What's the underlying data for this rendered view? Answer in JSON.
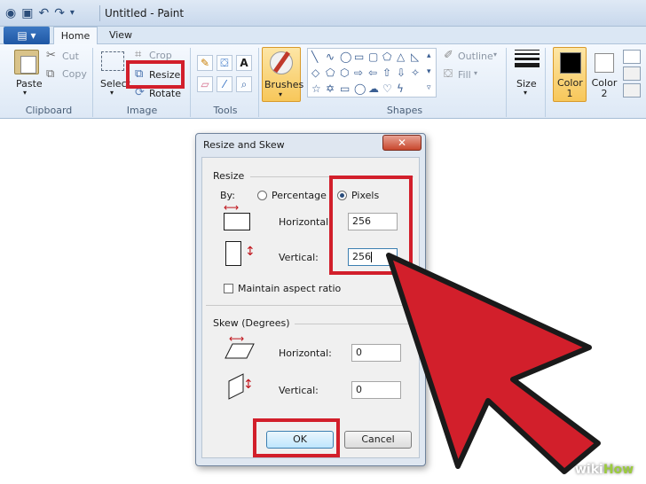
{
  "window": {
    "title": "Untitled - Paint"
  },
  "tabs": [
    {
      "label": "Home"
    },
    {
      "label": "View"
    }
  ],
  "ribbon": {
    "clipboard": {
      "label": "Clipboard",
      "paste": "Paste",
      "cut": "Cut",
      "copy": "Copy"
    },
    "image": {
      "label": "Image",
      "select": "Select",
      "crop": "Crop",
      "resize": "Resize",
      "rotate": "Rotate"
    },
    "tools": {
      "label": "Tools"
    },
    "brushes": {
      "label": "Brushes"
    },
    "shapes": {
      "label": "Shapes",
      "outline": "Outline",
      "fill": "Fill"
    },
    "size": {
      "label": "Size"
    },
    "color1": {
      "label": "Color\n1"
    },
    "color2": {
      "label": "Color\n2"
    }
  },
  "colors": {
    "color1": "#000000",
    "color2": "#ffffff",
    "highlight": "#d21f2b"
  },
  "dialog": {
    "title": "Resize and Skew",
    "resize": {
      "label": "Resize",
      "by": "By:",
      "percentage": "Percentage",
      "pixels": "Pixels",
      "selected": "Pixels",
      "horizontal_label": "Horizontal:",
      "horizontal_value": "256",
      "vertical_label": "Vertical:",
      "vertical_value": "256",
      "maintain_aspect": "Maintain aspect ratio"
    },
    "skew": {
      "label": "Skew (Degrees)",
      "horizontal_label": "Horizontal:",
      "horizontal_value": "0",
      "vertical_label": "Vertical:",
      "vertical_value": "0"
    },
    "ok": "OK",
    "cancel": "Cancel"
  },
  "watermark": {
    "wiki": "wiki",
    "how": "How"
  }
}
